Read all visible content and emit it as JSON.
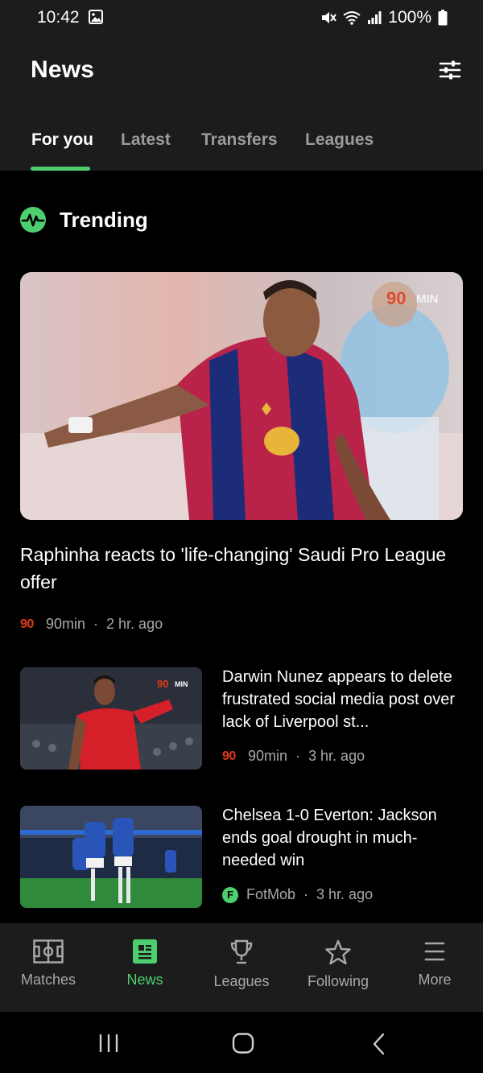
{
  "status_bar": {
    "time": "10:42",
    "battery": "100%",
    "icons": [
      "image-icon",
      "mute-icon",
      "wifi-icon",
      "signal-icon",
      "battery-icon"
    ]
  },
  "header": {
    "title": "News",
    "filter_icon": "sliders-icon"
  },
  "tabs": [
    {
      "label": "For you",
      "active": true
    },
    {
      "label": "Latest",
      "active": false
    },
    {
      "label": "Transfers",
      "active": false
    },
    {
      "label": "Leagues",
      "active": false
    }
  ],
  "trending": {
    "title": "Trending",
    "icon": "pulse-icon"
  },
  "hero_article": {
    "image_watermark": "90MIN",
    "title": "Raphinha reacts to 'life-changing' Saudi Pro League offer",
    "source_logo": "90",
    "source": "90min",
    "time": "2 hr. ago"
  },
  "articles": [
    {
      "image_watermark": "90MIN",
      "title": "Darwin Nunez appears to delete frustrated social media post over lack of Liverpool st...",
      "source_logo": "90",
      "source": "90min",
      "time": "3 hr. ago"
    },
    {
      "title": "Chelsea 1-0 Everton: Jackson ends goal drought in much-needed win",
      "source_logo": "F",
      "source": "FotMob",
      "time": "3 hr. ago"
    }
  ],
  "meta_separator": "·",
  "bottom_nav": [
    {
      "label": "Matches",
      "icon": "pitch-icon",
      "active": false
    },
    {
      "label": "News",
      "icon": "news-icon",
      "active": true
    },
    {
      "label": "Leagues",
      "icon": "trophy-icon",
      "active": false
    },
    {
      "label": "Following",
      "icon": "star-icon",
      "active": false
    },
    {
      "label": "More",
      "icon": "menu-icon",
      "active": false
    }
  ],
  "colors": {
    "accent": "#4ecf6f",
    "surface": "#1c1c1c",
    "background": "#000000",
    "brand_90min": "#e23a1a"
  }
}
